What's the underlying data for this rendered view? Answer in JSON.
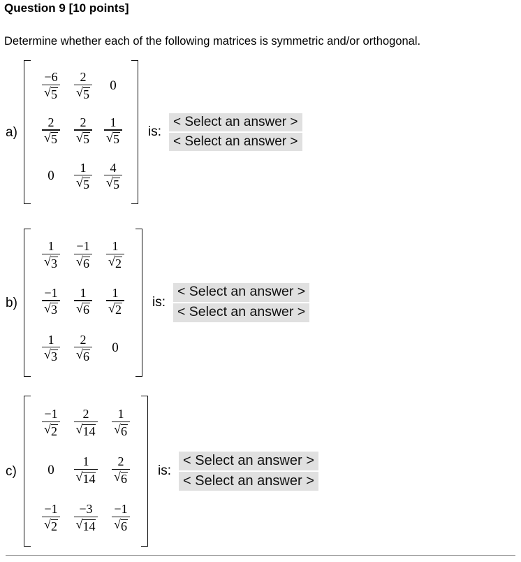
{
  "header": {
    "title": "Question 9 [10 points]",
    "prompt": "Determine whether each of the following matrices is symmetric and/or orthogonal."
  },
  "labels": {
    "is": "is:",
    "select_placeholder": "< Select an answer >"
  },
  "colors": {
    "select_background": "#e0e0e0",
    "text": "#000000",
    "rule": "#9a9a9a"
  },
  "problems": [
    {
      "label": "a)",
      "is_label": "is:",
      "matrix": {
        "rows": 3,
        "cols": 3,
        "cells": [
          [
            {
              "type": "fraction",
              "numerator": "−6",
              "denominator_root": "5"
            },
            {
              "type": "fraction",
              "numerator": "2",
              "denominator_root": "5"
            },
            {
              "type": "plain",
              "value": "0"
            }
          ],
          [
            {
              "type": "fraction",
              "numerator": "2",
              "denominator_root": "5"
            },
            {
              "type": "fraction",
              "numerator": "2",
              "denominator_root": "5"
            },
            {
              "type": "fraction",
              "numerator": "1",
              "denominator_root": "5"
            }
          ],
          [
            {
              "type": "plain",
              "value": "0"
            },
            {
              "type": "fraction",
              "numerator": "1",
              "denominator_root": "5"
            },
            {
              "type": "fraction",
              "numerator": "4",
              "denominator_root": "5"
            }
          ]
        ]
      },
      "selects": [
        {
          "value": "< Select an answer >"
        },
        {
          "value": "< Select an answer >"
        }
      ]
    },
    {
      "label": "b)",
      "is_label": "is:",
      "matrix": {
        "rows": 3,
        "cols": 3,
        "cells": [
          [
            {
              "type": "fraction",
              "numerator": "1",
              "denominator_root": "3"
            },
            {
              "type": "fraction",
              "numerator": "−1",
              "denominator_root": "6"
            },
            {
              "type": "fraction",
              "numerator": "1",
              "denominator_root": "2"
            }
          ],
          [
            {
              "type": "fraction",
              "numerator": "−1",
              "denominator_root": "3"
            },
            {
              "type": "fraction",
              "numerator": "1",
              "denominator_root": "6"
            },
            {
              "type": "fraction",
              "numerator": "1",
              "denominator_root": "2"
            }
          ],
          [
            {
              "type": "fraction",
              "numerator": "1",
              "denominator_root": "3"
            },
            {
              "type": "fraction",
              "numerator": "2",
              "denominator_root": "6"
            },
            {
              "type": "plain",
              "value": "0"
            }
          ]
        ]
      },
      "selects": [
        {
          "value": "< Select an answer >"
        },
        {
          "value": "< Select an answer >"
        }
      ]
    },
    {
      "label": "c)",
      "is_label": "is:",
      "matrix": {
        "rows": 3,
        "cols": 3,
        "cells": [
          [
            {
              "type": "fraction",
              "numerator": "−1",
              "denominator_root": "2"
            },
            {
              "type": "fraction",
              "numerator": "2",
              "denominator_root": "14"
            },
            {
              "type": "fraction",
              "numerator": "1",
              "denominator_root": "6"
            }
          ],
          [
            {
              "type": "plain",
              "value": "0"
            },
            {
              "type": "fraction",
              "numerator": "1",
              "denominator_root": "14"
            },
            {
              "type": "fraction",
              "numerator": "2",
              "denominator_root": "6"
            }
          ],
          [
            {
              "type": "fraction",
              "numerator": "−1",
              "denominator_root": "2"
            },
            {
              "type": "fraction",
              "numerator": "−3",
              "denominator_root": "14"
            },
            {
              "type": "fraction",
              "numerator": "−1",
              "denominator_root": "6"
            }
          ]
        ]
      },
      "selects": [
        {
          "value": "< Select an answer >"
        },
        {
          "value": "< Select an answer >"
        }
      ]
    }
  ]
}
